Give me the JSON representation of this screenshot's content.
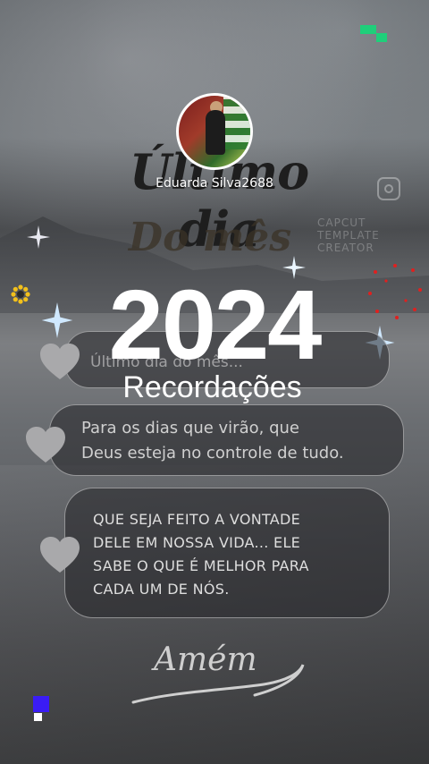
{
  "profile": {
    "username": "Eduarda Silva2688"
  },
  "background_text": {
    "line1": "Último dia",
    "line2": "Do mês",
    "watermark": "CAPCUT TEMPLATE CREATOR"
  },
  "headline": {
    "year": "2024",
    "subtitle": "Recordações"
  },
  "cards": [
    {
      "text": "Último dia do mês..."
    },
    {
      "line1": "Para os dias que virão, que",
      "line2": "Deus esteja no controle de tudo."
    },
    {
      "line1": "QUE SEJA FEITO A VONTADE",
      "line2": "DELE EM NOSSA VIDA... ELE",
      "line3": "SABE O QUE É MELHOR PARA",
      "line4": "CADA UM DE NÓS."
    }
  ],
  "footer": {
    "signature": "Amém"
  },
  "colors": {
    "accent_green": "#1fcf7a",
    "accent_blue": "#3a1cf5",
    "sparkle_red": "#e0201f",
    "sunflower_yellow": "#f2c01c"
  },
  "icons": [
    "heart-icon",
    "sparkle-icon",
    "instagram-icon",
    "sunflower-icon"
  ]
}
